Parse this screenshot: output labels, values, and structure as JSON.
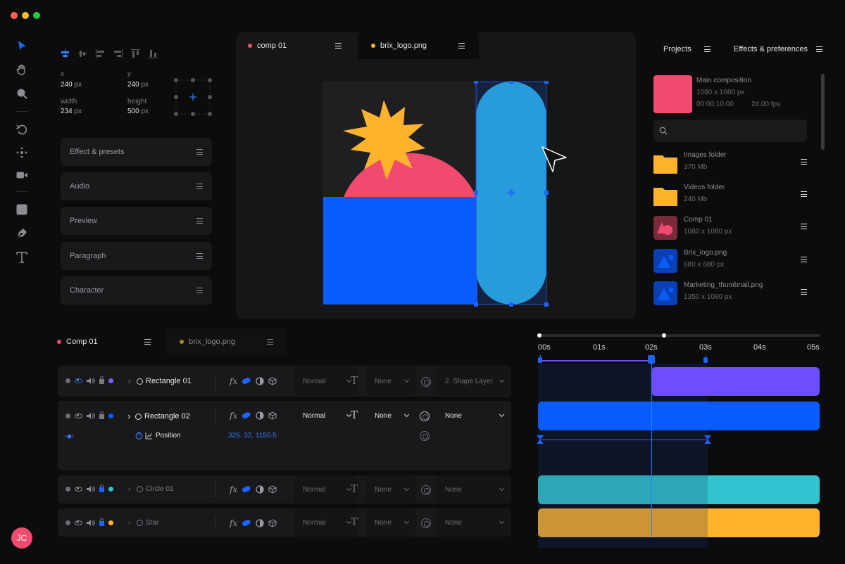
{
  "colors": {
    "background": "#0c0c0d",
    "accent_blue": "#0b5cff",
    "pink": "#f04a6e",
    "yellow": "#ffb32d",
    "purple": "#6e4dff",
    "cyan": "#33c3ce",
    "light_blue": "#2fa9d4"
  },
  "window_controls": [
    "close",
    "minimize",
    "maximize"
  ],
  "toolbar": {
    "tools": [
      "select-arrow-icon",
      "hand-icon",
      "zoom-icon",
      "undo-icon",
      "move-icon",
      "camera-icon",
      "rectangle-icon",
      "pen-icon",
      "text-icon"
    ],
    "user_initials": "JC"
  },
  "properties": {
    "x_label": "x",
    "x_value": "240",
    "x_unit": "px",
    "y_label": "y",
    "y_value": "240",
    "y_unit": "px",
    "width_label": "width",
    "width_value": "234",
    "width_unit": "px",
    "height_label": "height",
    "height_value": "500",
    "height_unit": "px",
    "panels": [
      "Effect & presets",
      "Audio",
      "Preview",
      "Paragraph",
      "Character"
    ]
  },
  "canvas": {
    "tabs": [
      {
        "label": "comp 01",
        "color": "#f04a6e"
      },
      {
        "label": "brix_logo.png",
        "color": "#ffb32d"
      }
    ]
  },
  "projects": {
    "tab_projects": "Projects",
    "tab_effects": "Effects & preferences",
    "main": {
      "name": "Main composition",
      "size": "1080 x 1080 px",
      "timecode": "00:00:10:00",
      "fps": "24.00 fps"
    },
    "search_placeholder": "",
    "items": [
      {
        "name": "Images folder",
        "meta": "370 Mb",
        "icon": "folder-icon"
      },
      {
        "name": "Videos folder",
        "meta": "240 Mb",
        "icon": "folder-icon"
      },
      {
        "name": "Comp 01",
        "meta": "1080 x 1080 px",
        "icon": "shapes-icon"
      },
      {
        "name": "Brix_logo.png",
        "meta": "680 x 680 px",
        "icon": "triangle-image-icon"
      },
      {
        "name": "Marketing_thumbnail.png",
        "meta": "1350 x 1080 px",
        "icon": "triangle-image-icon"
      }
    ]
  },
  "layers": {
    "tabs": [
      {
        "label": "Comp 01",
        "color": "#f04a6e"
      },
      {
        "label": "brix_logo.png",
        "color": "#a9862a"
      }
    ],
    "rows": [
      {
        "name": "Rectangle 01",
        "color": "#7b61ff",
        "blend": "Normal",
        "track": "None",
        "parent": "2. Shape Layer"
      },
      {
        "name": "Rectangle 02",
        "color": "#0b5cff",
        "blend": "Normal",
        "track": "None",
        "parent": "None"
      },
      {
        "name": "Circle 01",
        "color": "#33c3ce",
        "blend": "Normal",
        "track": "None",
        "parent": "None"
      },
      {
        "name": "Star",
        "color": "#ffb32d",
        "blend": "Normal",
        "track": "None",
        "parent": "None"
      }
    ],
    "property_name": "Position",
    "property_value": "325. 32, 1150.5"
  },
  "timeline": {
    "ticks": [
      "00s",
      "01s",
      "02s",
      "03s",
      "04s",
      "05s"
    ],
    "playhead_seconds": 2
  }
}
